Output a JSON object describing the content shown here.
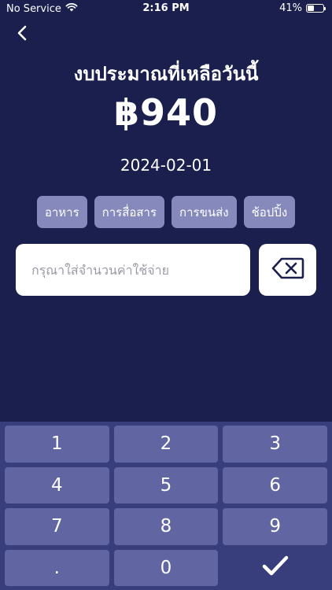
{
  "status_bar": {
    "carrier": "No Service",
    "time": "2:16 PM",
    "battery": "41%",
    "battery_level": 0.41
  },
  "header": {
    "title": "งบประมาณที่เหลือวันนี้",
    "amount": "฿940",
    "date": "2024-02-01"
  },
  "categories": [
    "อาหาร",
    "การสื่อสาร",
    "การขนส่ง",
    "ช้อปปิ้ง"
  ],
  "expense_input": {
    "placeholder": "กรุณาใส่จำนวนค่าใช้จ่าย",
    "value": ""
  },
  "keypad": {
    "keys": [
      "1",
      "2",
      "3",
      "4",
      "5",
      "6",
      "7",
      "8",
      "9",
      ".",
      "0"
    ]
  },
  "colors": {
    "background": "#1b1f4e",
    "chip": "#8589bb",
    "keypad_bg": "#383d7c",
    "key": "#6166a3"
  },
  "icons": {
    "back": "chevron-left-icon",
    "delete": "backspace-icon",
    "confirm": "checkmark-icon",
    "wifi": "wifi-icon"
  }
}
